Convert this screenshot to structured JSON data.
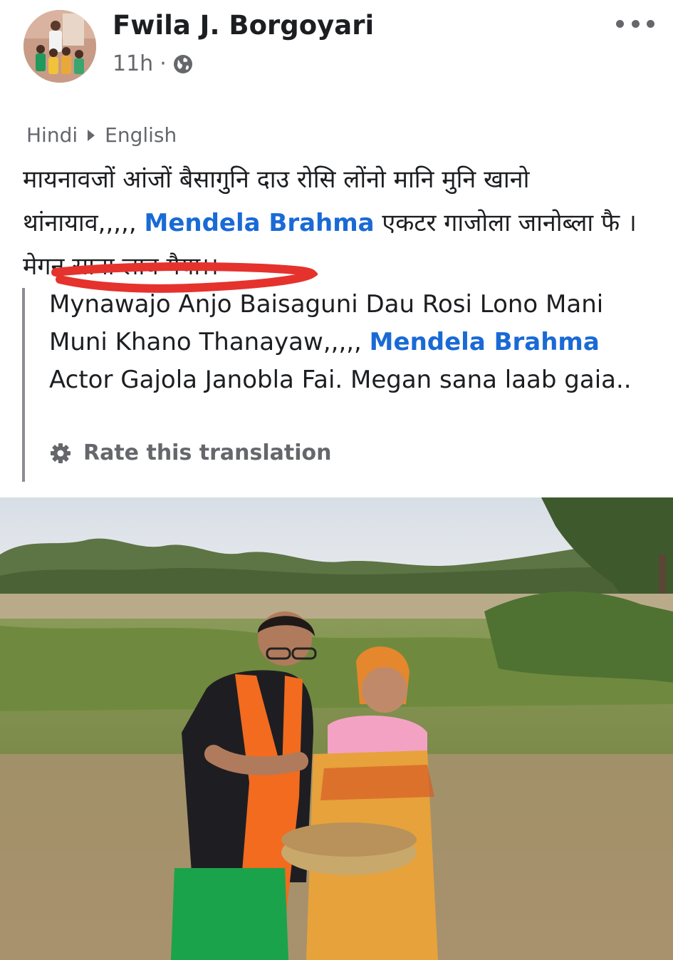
{
  "post": {
    "author": "Fwila J. Borgoyari",
    "time": "11h",
    "separator": "·",
    "audience_icon": "globe-icon",
    "more_icon": "more-options-icon"
  },
  "translation_toggle": {
    "from": "Hindi",
    "to": "English",
    "arrow_icon": "play-arrow-icon"
  },
  "original": {
    "part1": "मायनावजों आंजों बैसागुनि दाउ रोसि लोंनो मानि मुनि खानो थांनायाव,,,,, ",
    "mention": "Mendela Brahma",
    "part2": " एकटर गाजोला जानोब्ला फै । मेगन साना लाब गैया।।",
    "highlight_color": "#e5322d"
  },
  "translated": {
    "part1": "Mynawajo Anjo Baisaguni Dau Rosi Lono Mani Muni Khano Thanayaw,,,,, ",
    "mention": "Mendela Brahma",
    "part2": " Actor Gajola Janobla Fai. Megan sana laab gaia..",
    "rate_label": "Rate this translation",
    "rate_icon": "gear-icon"
  },
  "colors": {
    "mention": "#1a6ad6",
    "secondary_text": "#65676b",
    "primary_text": "#1c1e21"
  }
}
